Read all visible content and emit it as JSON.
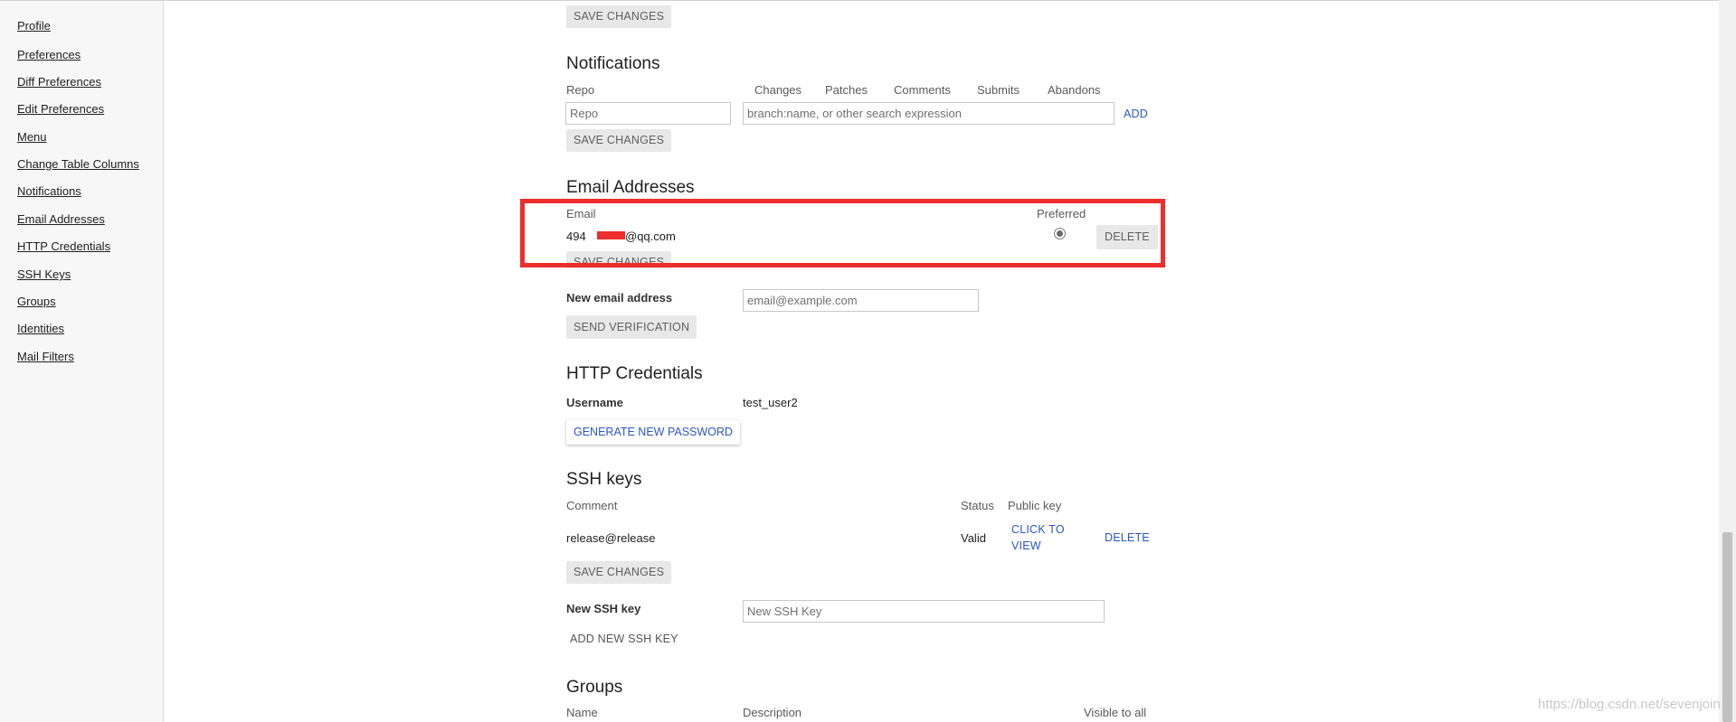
{
  "sidebar": {
    "items": [
      {
        "label": "Profile"
      },
      {
        "label": "Preferences"
      },
      {
        "label": "Diff Preferences"
      },
      {
        "label": "Edit Preferences"
      },
      {
        "label": "Menu"
      },
      {
        "label": "Change Table Columns"
      },
      {
        "label": "Notifications"
      },
      {
        "label": "Email Addresses"
      },
      {
        "label": "HTTP Credentials"
      },
      {
        "label": "SSH Keys"
      },
      {
        "label": "Groups"
      },
      {
        "label": "Identities"
      },
      {
        "label": "Mail Filters"
      }
    ]
  },
  "top": {
    "save_label": "SAVE CHANGES"
  },
  "notifications": {
    "title": "Notifications",
    "col_repo": "Repo",
    "col_changes": "Changes",
    "col_patches": "Patches",
    "col_comments": "Comments",
    "col_submits": "Submits",
    "col_abandons": "Abandons",
    "repo_placeholder": "Repo",
    "filter_placeholder": "branch:name, or other search expression",
    "add_label": "ADD",
    "save_label": "SAVE CHANGES"
  },
  "email": {
    "title": "Email Addresses",
    "col_email": "Email",
    "col_preferred": "Preferred",
    "address_prefix": "494",
    "address_suffix": "@qq.com",
    "delete_label": "DELETE",
    "save_label": "SAVE CHANGES",
    "new_label": "New email address",
    "new_placeholder": "email@example.com",
    "send_label": "SEND VERIFICATION",
    "highlight_color": "#ee2d2d"
  },
  "http": {
    "title": "HTTP Credentials",
    "username_label": "Username",
    "username_value": "test_user2",
    "generate_label": "GENERATE NEW PASSWORD"
  },
  "ssh": {
    "title": "SSH keys",
    "col_comment": "Comment",
    "col_status": "Status",
    "col_public_key": "Public key",
    "row_comment": "release@release",
    "row_status": "Valid",
    "view_line1": "CLICK TO",
    "view_line2": "VIEW",
    "delete_label": "DELETE",
    "save_label": "SAVE CHANGES",
    "new_label": "New SSH key",
    "new_placeholder": "New SSH Key",
    "add_label": "ADD NEW SSH KEY"
  },
  "groups": {
    "title": "Groups",
    "col_name": "Name",
    "col_description": "Description",
    "col_visible": "Visible to all"
  },
  "watermark": "https://blog.csdn.net/sevenjoin",
  "colors": {
    "link": "#2a56c6",
    "button_gray": "#e8e8e8"
  }
}
